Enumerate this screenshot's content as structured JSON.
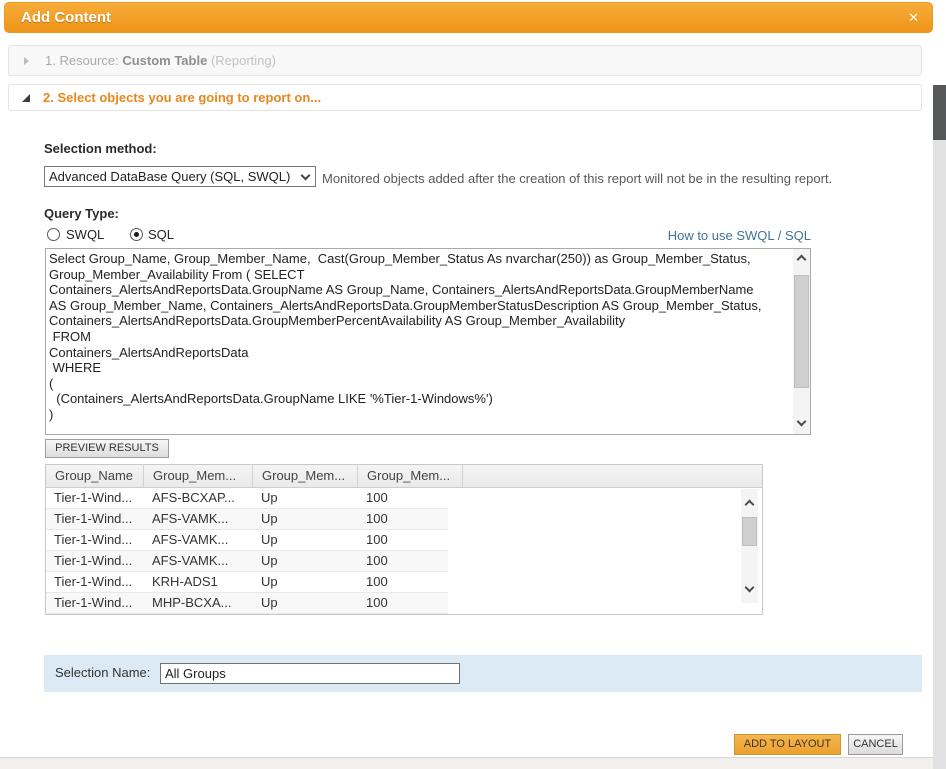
{
  "dialog": {
    "title": "Add Content",
    "close_icon": "✕"
  },
  "steps": {
    "step1": {
      "prefix": "1. Resource: ",
      "resource": "Custom Table",
      "suffix": " (Reporting)"
    },
    "step2": {
      "label": "2. Select objects you are going to report on..."
    }
  },
  "selection_method": {
    "label": "Selection method:",
    "value": "Advanced DataBase Query (SQL, SWQL)",
    "note": "Monitored objects added after the creation of this report will not be in the resulting report."
  },
  "query_type": {
    "label": "Query Type:",
    "options": [
      {
        "label": "SWQL",
        "selected": false
      },
      {
        "label": "SQL",
        "selected": true
      }
    ],
    "help_link": "How to use SWQL / SQL"
  },
  "query_editor": {
    "text": "Select Group_Name, Group_Member_Name,  Cast(Group_Member_Status As nvarchar(250)) as Group_Member_Status,\nGroup_Member_Availability From ( SELECT\nContainers_AlertsAndReportsData.GroupName AS Group_Name, Containers_AlertsAndReportsData.GroupMemberName\nAS Group_Member_Name, Containers_AlertsAndReportsData.GroupMemberStatusDescription AS Group_Member_Status,\nContainers_AlertsAndReportsData.GroupMemberPercentAvailability AS Group_Member_Availability\n FROM\nContainers_AlertsAndReportsData\n WHERE\n(\n  (Containers_AlertsAndReportsData.GroupName LIKE '%Tier-1-Windows%')\n)"
  },
  "preview": {
    "button_label": "PREVIEW RESULTS",
    "table": {
      "columns": [
        "Group_Name",
        "Group_Mem...",
        "Group_Mem...",
        "Group_Mem..."
      ],
      "rows": [
        [
          "Tier-1-Wind...",
          "AFS-BCXAP...",
          "Up",
          "100"
        ],
        [
          "Tier-1-Wind...",
          "AFS-VAMK...",
          "Up",
          "100"
        ],
        [
          "Tier-1-Wind...",
          "AFS-VAMK...",
          "Up",
          "100"
        ],
        [
          "Tier-1-Wind...",
          "AFS-VAMK...",
          "Up",
          "100"
        ],
        [
          "Tier-1-Wind...",
          "KRH-ADS1",
          "Up",
          "100"
        ],
        [
          "Tier-1-Wind...",
          "MHP-BCXA...",
          "Up",
          "100"
        ]
      ]
    }
  },
  "selection_name": {
    "label": "Selection Name:",
    "value": "All Groups"
  },
  "footer": {
    "add_button": "ADD TO LAYOUT",
    "cancel_button": "CANCEL"
  },
  "colors": {
    "header_orange_top": "#F7AC3B",
    "header_orange_bottom": "#EE9517",
    "accent_orange": "#E8871C",
    "link_blue": "#3F7296",
    "band_blue": "#DBEAF4",
    "add_button_amber": "#ECA02F"
  }
}
